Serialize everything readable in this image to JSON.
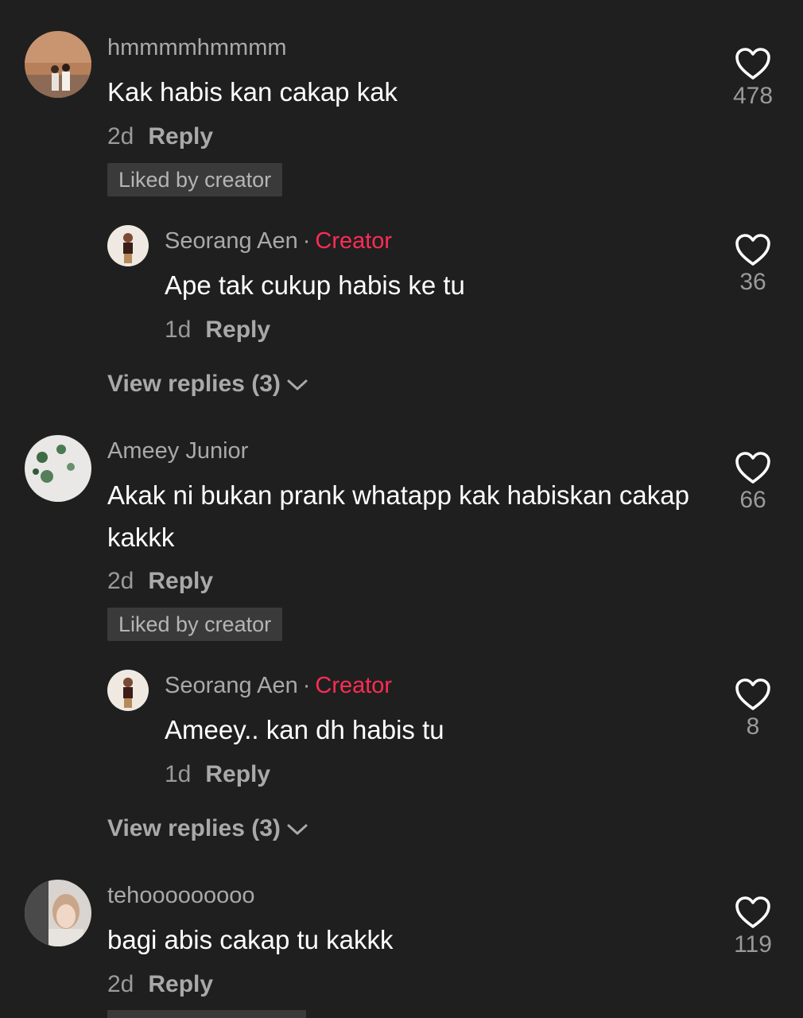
{
  "colors": {
    "background": "#1f1f1f",
    "creator": "#fe2c55",
    "muted": "#a9a9a9"
  },
  "comments": [
    {
      "username": "hmmmmhmmmm",
      "text": "Kak habis kan cakap kak",
      "age": "2d",
      "reply": "Reply",
      "liked_badge": "Liked by creator",
      "likes": "478",
      "reply_item": {
        "username": "Seorang Aen",
        "separator": "·",
        "creator_label": "Creator",
        "text": "Ape tak cukup habis ke tu",
        "age": "1d",
        "reply": "Reply",
        "likes": "36"
      },
      "view_replies": "View replies (3)"
    },
    {
      "username": "Ameey Junior",
      "text": "Akak ni bukan prank whatapp kak habiskan cakap kakkk",
      "age": "2d",
      "reply": "Reply",
      "liked_badge": "Liked by creator",
      "likes": "66",
      "reply_item": {
        "username": "Seorang Aen",
        "separator": "·",
        "creator_label": "Creator",
        "text": "Ameey.. kan dh habis tu",
        "age": "1d",
        "reply": "Reply",
        "likes": "8"
      },
      "view_replies": "View replies (3)"
    },
    {
      "username": "tehooooooooo",
      "text": "bagi abis cakap tu kakkk",
      "age": "2d",
      "reply": "Reply",
      "likes": "119"
    }
  ]
}
